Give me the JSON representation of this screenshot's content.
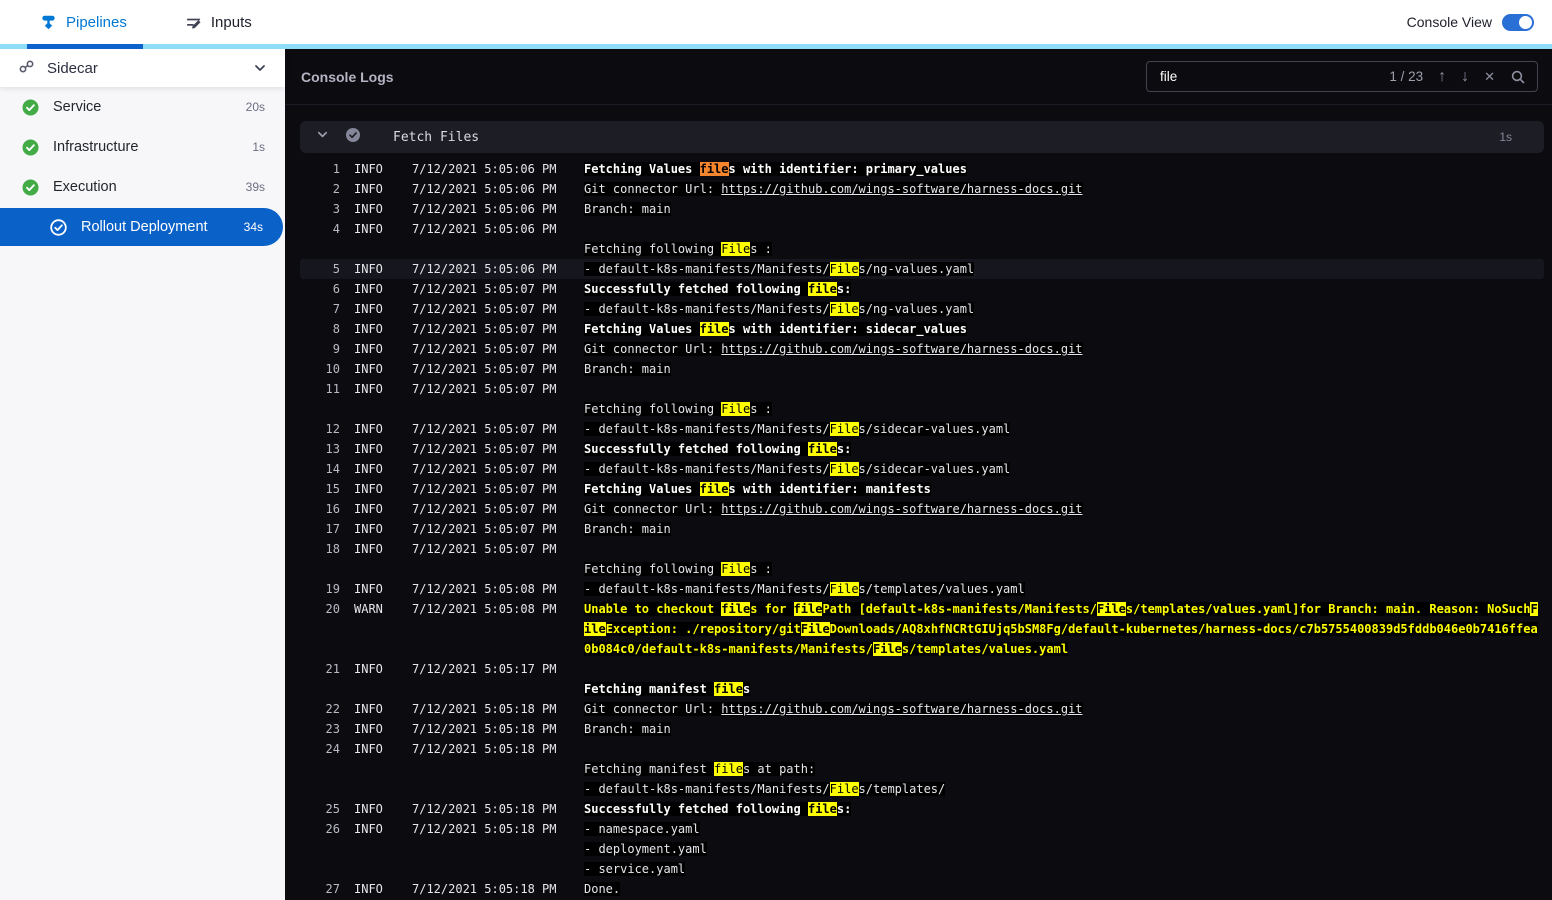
{
  "header": {
    "tabs": [
      {
        "label": "Pipelines",
        "active": true
      },
      {
        "label": "Inputs",
        "active": false
      }
    ],
    "console_view_label": "Console View",
    "console_view_on": true
  },
  "sidebar": {
    "title": "Sidecar",
    "items": [
      {
        "label": "Service",
        "duration": "20s",
        "status": "success",
        "selected": false
      },
      {
        "label": "Infrastructure",
        "duration": "1s",
        "status": "success",
        "selected": false
      },
      {
        "label": "Execution",
        "duration": "39s",
        "status": "success",
        "selected": false
      },
      {
        "label": "Rollout Deployment",
        "duration": "34s",
        "status": "success",
        "selected": true
      }
    ]
  },
  "console": {
    "title": "Console Logs",
    "search": {
      "value": "file",
      "count": "1 / 23",
      "up_icon": "↑",
      "down_icon": "↓",
      "close_icon": "✕"
    },
    "section": {
      "title": "Fetch Files",
      "duration": "1s"
    },
    "colors": {
      "match_highlight": "#ffff00",
      "current_match_highlight": "#f6862e",
      "warn_text": "#ffff00",
      "selected_step": "#0a62c9",
      "accent_blue": "#0278d5",
      "success_green": "#42ab45"
    },
    "lines": [
      {
        "n": 1,
        "level": "INFO",
        "time": "7/12/2021 5:05:06 PM",
        "style": "bold",
        "msg": [
          [
            {
              "t": "Fetching Values "
            },
            {
              "t": "file",
              "h": "c"
            },
            {
              "t": "s with identifier: primary_values"
            }
          ]
        ]
      },
      {
        "n": 2,
        "level": "INFO",
        "time": "7/12/2021 5:05:06 PM",
        "msg": [
          [
            {
              "t": "Git connector Url: "
            },
            {
              "t": "https://github.com/wings-software/harness-docs.git",
              "a": true
            }
          ]
        ]
      },
      {
        "n": 3,
        "level": "INFO",
        "time": "7/12/2021 5:05:06 PM",
        "msg": [
          [
            {
              "t": "Branch: main"
            }
          ]
        ]
      },
      {
        "n": 4,
        "level": "INFO",
        "time": "7/12/2021 5:05:06 PM",
        "msg": [
          [],
          [
            {
              "t": "Fetching following "
            },
            {
              "t": "File",
              "h": "m"
            },
            {
              "t": "s :"
            }
          ]
        ]
      },
      {
        "n": 5,
        "level": "INFO",
        "time": "7/12/2021 5:05:06 PM",
        "active": true,
        "msg": [
          [
            {
              "t": "- default-k8s-manifests/Manifests/"
            },
            {
              "t": "File",
              "h": "m"
            },
            {
              "t": "s/ng-values.yaml"
            }
          ]
        ]
      },
      {
        "n": 6,
        "level": "INFO",
        "time": "7/12/2021 5:05:07 PM",
        "style": "bold",
        "msg": [
          [
            {
              "t": "Successfully fetched following "
            },
            {
              "t": "file",
              "h": "m"
            },
            {
              "t": "s:"
            }
          ]
        ]
      },
      {
        "n": 7,
        "level": "INFO",
        "time": "7/12/2021 5:05:07 PM",
        "msg": [
          [
            {
              "t": "- default-k8s-manifests/Manifests/"
            },
            {
              "t": "File",
              "h": "m"
            },
            {
              "t": "s/ng-values.yaml"
            }
          ]
        ]
      },
      {
        "n": 8,
        "level": "INFO",
        "time": "7/12/2021 5:05:07 PM",
        "style": "bold",
        "msg": [
          [
            {
              "t": "Fetching Values "
            },
            {
              "t": "file",
              "h": "m"
            },
            {
              "t": "s with identifier: sidecar_values"
            }
          ]
        ]
      },
      {
        "n": 9,
        "level": "INFO",
        "time": "7/12/2021 5:05:07 PM",
        "msg": [
          [
            {
              "t": "Git connector Url: "
            },
            {
              "t": "https://github.com/wings-software/harness-docs.git",
              "a": true
            }
          ]
        ]
      },
      {
        "n": 10,
        "level": "INFO",
        "time": "7/12/2021 5:05:07 PM",
        "msg": [
          [
            {
              "t": "Branch: main"
            }
          ]
        ]
      },
      {
        "n": 11,
        "level": "INFO",
        "time": "7/12/2021 5:05:07 PM",
        "msg": [
          [],
          [
            {
              "t": "Fetching following "
            },
            {
              "t": "File",
              "h": "m"
            },
            {
              "t": "s :"
            }
          ]
        ]
      },
      {
        "n": 12,
        "level": "INFO",
        "time": "7/12/2021 5:05:07 PM",
        "msg": [
          [
            {
              "t": "- default-k8s-manifests/Manifests/"
            },
            {
              "t": "File",
              "h": "m"
            },
            {
              "t": "s/sidecar-values.yaml"
            }
          ]
        ]
      },
      {
        "n": 13,
        "level": "INFO",
        "time": "7/12/2021 5:05:07 PM",
        "style": "bold",
        "msg": [
          [
            {
              "t": "Successfully fetched following "
            },
            {
              "t": "file",
              "h": "m"
            },
            {
              "t": "s:"
            }
          ]
        ]
      },
      {
        "n": 14,
        "level": "INFO",
        "time": "7/12/2021 5:05:07 PM",
        "msg": [
          [
            {
              "t": "- default-k8s-manifests/Manifests/"
            },
            {
              "t": "File",
              "h": "m"
            },
            {
              "t": "s/sidecar-values.yaml"
            }
          ]
        ]
      },
      {
        "n": 15,
        "level": "INFO",
        "time": "7/12/2021 5:05:07 PM",
        "style": "bold",
        "msg": [
          [
            {
              "t": "Fetching Values "
            },
            {
              "t": "file",
              "h": "m"
            },
            {
              "t": "s with identifier: manifests"
            }
          ]
        ]
      },
      {
        "n": 16,
        "level": "INFO",
        "time": "7/12/2021 5:05:07 PM",
        "msg": [
          [
            {
              "t": "Git connector Url: "
            },
            {
              "t": "https://github.com/wings-software/harness-docs.git",
              "a": true
            }
          ]
        ]
      },
      {
        "n": 17,
        "level": "INFO",
        "time": "7/12/2021 5:05:07 PM",
        "msg": [
          [
            {
              "t": "Branch: main"
            }
          ]
        ]
      },
      {
        "n": 18,
        "level": "INFO",
        "time": "7/12/2021 5:05:07 PM",
        "msg": [
          [],
          [
            {
              "t": "Fetching following "
            },
            {
              "t": "File",
              "h": "m"
            },
            {
              "t": "s :"
            }
          ]
        ]
      },
      {
        "n": 19,
        "level": "INFO",
        "time": "7/12/2021 5:05:08 PM",
        "msg": [
          [
            {
              "t": "- default-k8s-manifests/Manifests/"
            },
            {
              "t": "File",
              "h": "m"
            },
            {
              "t": "s/templates/values.yaml"
            }
          ]
        ]
      },
      {
        "n": 20,
        "level": "WARN",
        "time": "7/12/2021 5:05:08 PM",
        "style": "warn",
        "msg": [
          [
            {
              "t": "Unable to checkout "
            },
            {
              "t": "file",
              "h": "m"
            },
            {
              "t": "s for "
            },
            {
              "t": "file",
              "h": "m"
            },
            {
              "t": "Path [default-k8s-manifests/Manifests/"
            },
            {
              "t": "File",
              "h": "m"
            },
            {
              "t": "s/templates/values.yaml]for Branch: main. Reason: NoSuch"
            },
            {
              "t": "File",
              "h": "m"
            },
            {
              "t": "Exception: ./repository/git"
            },
            {
              "t": "File",
              "h": "m"
            },
            {
              "t": "Downloads/AQ8xhfNCRtGIUjq5bSM8Fg/default-kubernetes/harness-docs/c7b5755400839d5fddb046e0b7416ffea0b084c0/default-k8s-manifests/Manifests/"
            },
            {
              "t": "File",
              "h": "m"
            },
            {
              "t": "s/templates/values.yaml"
            }
          ]
        ]
      },
      {
        "n": 21,
        "level": "INFO",
        "time": "7/12/2021 5:05:17 PM",
        "style": "bold",
        "msg": [
          [],
          [
            {
              "t": "Fetching manifest "
            },
            {
              "t": "file",
              "h": "m"
            },
            {
              "t": "s"
            }
          ]
        ]
      },
      {
        "n": 22,
        "level": "INFO",
        "time": "7/12/2021 5:05:18 PM",
        "msg": [
          [
            {
              "t": "Git connector Url: "
            },
            {
              "t": "https://github.com/wings-software/harness-docs.git",
              "a": true
            }
          ]
        ]
      },
      {
        "n": 23,
        "level": "INFO",
        "time": "7/12/2021 5:05:18 PM",
        "msg": [
          [
            {
              "t": "Branch: main"
            }
          ]
        ]
      },
      {
        "n": 24,
        "level": "INFO",
        "time": "7/12/2021 5:05:18 PM",
        "msg": [
          [],
          [
            {
              "t": "Fetching manifest "
            },
            {
              "t": "file",
              "h": "m"
            },
            {
              "t": "s at path:"
            }
          ],
          [
            {
              "t": "- default-k8s-manifests/Manifests/"
            },
            {
              "t": "File",
              "h": "m"
            },
            {
              "t": "s/templates/"
            }
          ]
        ]
      },
      {
        "n": 25,
        "level": "INFO",
        "time": "7/12/2021 5:05:18 PM",
        "style": "bold",
        "msg": [
          [
            {
              "t": "Successfully fetched following "
            },
            {
              "t": "file",
              "h": "m"
            },
            {
              "t": "s:"
            }
          ]
        ]
      },
      {
        "n": 26,
        "level": "INFO",
        "time": "7/12/2021 5:05:18 PM",
        "msg": [
          [
            {
              "t": "- namespace.yaml"
            }
          ],
          [
            {
              "t": "- deployment.yaml"
            }
          ],
          [
            {
              "t": "- service.yaml"
            }
          ]
        ]
      },
      {
        "n": 27,
        "level": "INFO",
        "time": "7/12/2021 5:05:18 PM",
        "msg": [
          [
            {
              "t": "Done."
            }
          ]
        ]
      }
    ]
  }
}
